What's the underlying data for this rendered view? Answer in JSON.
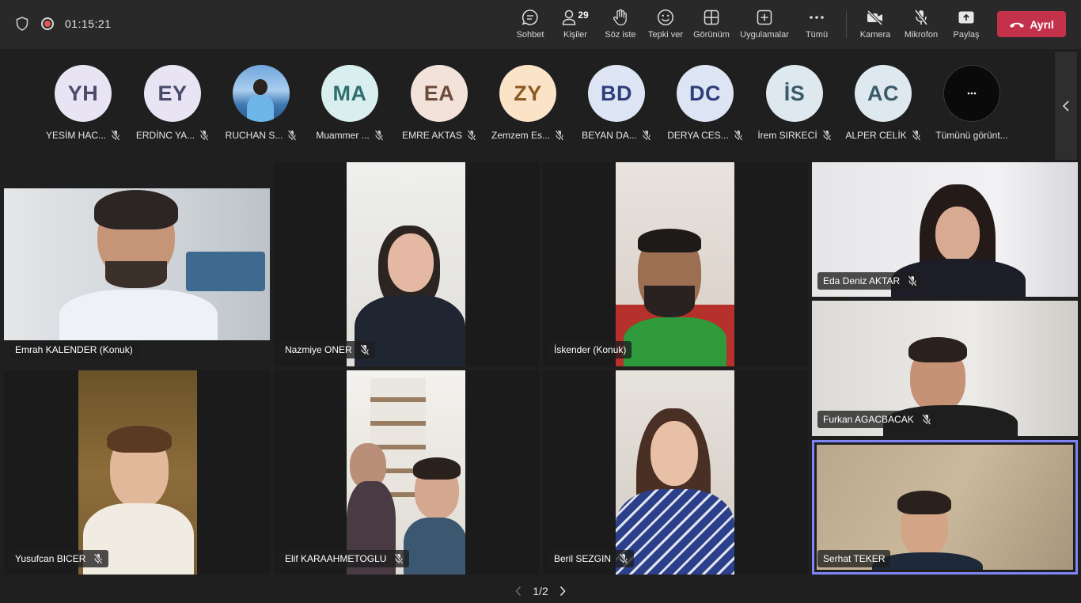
{
  "meeting": {
    "timer": "01:15:21"
  },
  "toolbar": {
    "chat_label": "Sohbet",
    "people_label": "Kişiler",
    "people_count": "29",
    "raise_hand_label": "Söz iste",
    "react_label": "Tepki ver",
    "view_label": "Görünüm",
    "apps_label": "Uygulamalar",
    "more_label": "Tümü",
    "camera_label": "Kamera",
    "mic_label": "Mikrofon",
    "share_label": "Paylaş",
    "leave_label": "Ayrıl"
  },
  "strip": {
    "participants": [
      {
        "initials": "YH",
        "name": "YESİM HAC...",
        "color": "#e8e4f4",
        "text_color": "#4a4a6a"
      },
      {
        "initials": "EY",
        "name": "ERDİNC YA...",
        "color": "#e8e4f4",
        "text_color": "#4a4a6a"
      },
      {
        "initials": "",
        "name": "RUCHAN S...",
        "color": "#5b8fc7",
        "text_color": "#ffffff"
      },
      {
        "initials": "MA",
        "name": "Muammer ...",
        "color": "#d9efef",
        "text_color": "#2f6f6f"
      },
      {
        "initials": "EA",
        "name": "EMRE AKTAS",
        "color": "#f2e2da",
        "text_color": "#6b4a3a"
      },
      {
        "initials": "ZY",
        "name": "Zemzem Es...",
        "color": "#fbe3c8",
        "text_color": "#8a5a20"
      },
      {
        "initials": "BD",
        "name": "BEYAN DA...",
        "color": "#dde4f4",
        "text_color": "#2f3f7a"
      },
      {
        "initials": "DC",
        "name": "DERYA CES...",
        "color": "#dde4f4",
        "text_color": "#2f3f7a"
      },
      {
        "initials": "İS",
        "name": "İrem SIRKECİ",
        "color": "#dde8ef",
        "text_color": "#3a5a6a"
      },
      {
        "initials": "AC",
        "name": "ALPER CELİK",
        "color": "#dde8ef",
        "text_color": "#3a5a6a"
      }
    ],
    "see_all_label": "Tümünü görünt..."
  },
  "videos": [
    {
      "name": "Emrah KALENDER (Konuk)",
      "muted": false
    },
    {
      "name": "Nazmiye ONER",
      "muted": true
    },
    {
      "name": "İskender (Konuk)",
      "muted": false
    },
    {
      "name": "Yusufcan BICER",
      "muted": true
    },
    {
      "name": "Elif KARAAHMETOGLU",
      "muted": true
    },
    {
      "name": "Beril SEZGIN",
      "muted": true
    },
    {
      "name": "Eda Deniz AKTAR",
      "muted": true
    },
    {
      "name": "Furkan AGACBACAK",
      "muted": true
    },
    {
      "name": "Serhat TEKER",
      "muted": false
    }
  ],
  "pager": {
    "label": "1/2"
  }
}
